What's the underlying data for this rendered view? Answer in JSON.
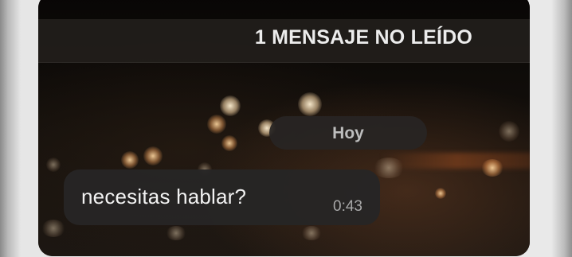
{
  "chat": {
    "unread_banner": "1 MENSAJE NO LEÍDO",
    "date_separator": "Hoy",
    "messages": [
      {
        "text": "necesitas hablar?",
        "time": "0:43",
        "direction": "incoming"
      }
    ]
  },
  "colors": {
    "banner_bg": "#221e1b",
    "bubble_bg": "#262525",
    "chip_bg": "#282523",
    "text_primary": "#f2f2f2",
    "text_secondary": "#a8a8a8"
  }
}
